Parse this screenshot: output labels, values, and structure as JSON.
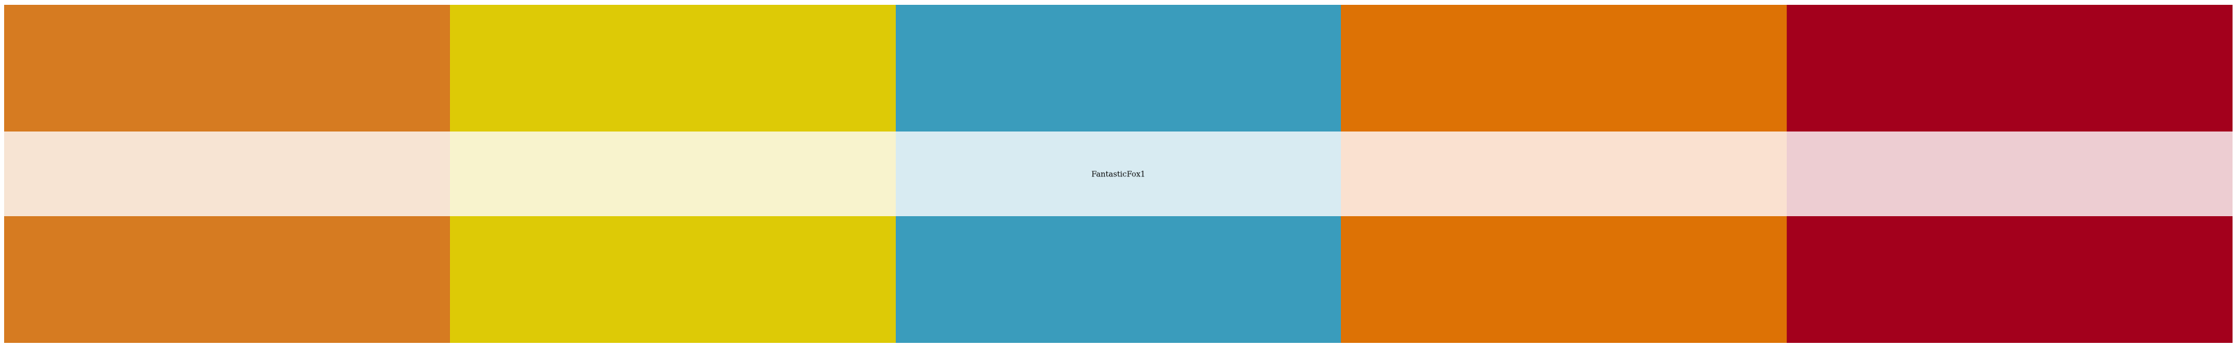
{
  "palette": {
    "name": "FantasticFox1",
    "colors": [
      "#D67B21",
      "#DDCA06",
      "#3A9CBC",
      "#DD7205",
      "#A3001C"
    ],
    "tints": [
      "#F7E4D3",
      "#F8F3CD",
      "#D8EBF2",
      "#FAE1D0",
      "#EDCDD2"
    ]
  }
}
